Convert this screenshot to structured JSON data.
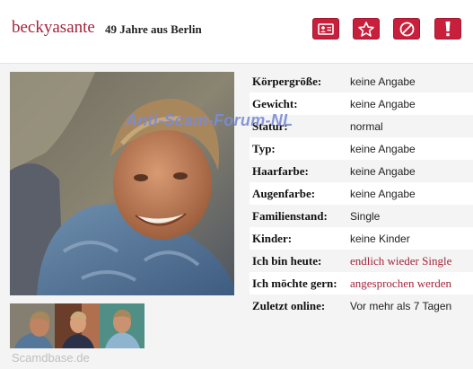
{
  "header": {
    "username": "beckyasante",
    "info": "49 Jahre aus Berlin",
    "actions": [
      {
        "icon": "id-card-icon"
      },
      {
        "icon": "star-icon"
      },
      {
        "icon": "block-icon"
      },
      {
        "icon": "report-icon"
      }
    ]
  },
  "colors": {
    "accent": "#c8203c",
    "name": "#a3243b"
  },
  "profile": {
    "details": [
      {
        "label": "Körpergröße:",
        "value": "keine Angabe"
      },
      {
        "label": "Gewicht:",
        "value": "keine Angabe"
      },
      {
        "label": "Statur:",
        "value": "normal"
      },
      {
        "label": "Typ:",
        "value": "keine Angabe"
      },
      {
        "label": "Haarfarbe:",
        "value": "keine Angabe"
      },
      {
        "label": "Augenfarbe:",
        "value": "keine Angabe"
      },
      {
        "label": "Familienstand:",
        "value": "Single"
      },
      {
        "label": "Kinder:",
        "value": "keine Kinder"
      },
      {
        "label": "Ich bin heute:",
        "value": "endlich wieder Single"
      },
      {
        "label": "Ich möchte gern:",
        "value": "angesprochen werden"
      },
      {
        "label": "Zuletzt online:",
        "value": "Vor mehr als 7 Tagen"
      }
    ]
  },
  "watermark": "Anti-Scam-Forum-NL",
  "footer_watermark": "Scamdbase.de"
}
